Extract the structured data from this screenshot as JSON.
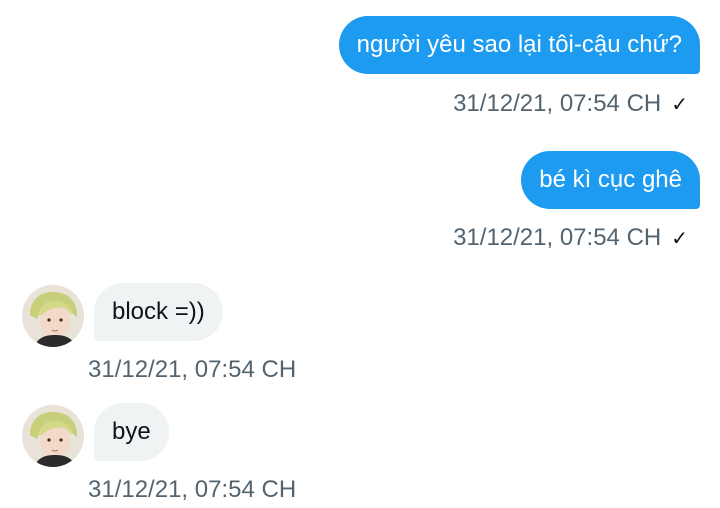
{
  "messages": [
    {
      "direction": "outgoing",
      "text": "người yêu sao lại tôi-cậu chứ?",
      "time": "31/12/21, 07:54 CH",
      "status_icon": "check-icon"
    },
    {
      "direction": "outgoing",
      "text": "bé kì cục ghê",
      "time": "31/12/21, 07:54 CH",
      "status_icon": "check-icon"
    },
    {
      "direction": "incoming",
      "text": "block =))",
      "time": "31/12/21, 07:54 CH",
      "avatar": "avatar-icon"
    },
    {
      "direction": "incoming",
      "text": "bye",
      "time": "31/12/21, 07:54 CH",
      "avatar": "avatar-icon"
    }
  ],
  "colors": {
    "outgoing_bubble": "#1d9bf0",
    "incoming_bubble": "#eff3f4",
    "timestamp": "#536471"
  }
}
